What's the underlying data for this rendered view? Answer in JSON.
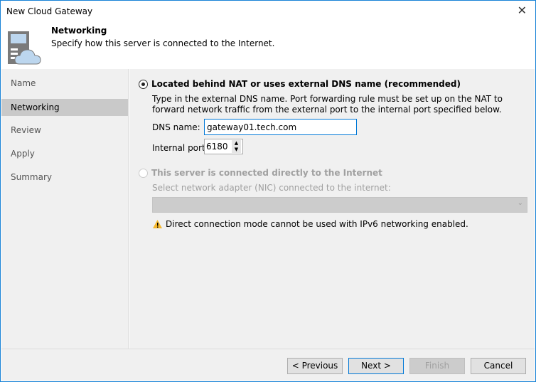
{
  "window": {
    "title": "New Cloud Gateway"
  },
  "header": {
    "title": "Networking",
    "subtitle": "Specify how this server is connected to the Internet."
  },
  "sidebar": {
    "items": [
      {
        "label": "Name"
      },
      {
        "label": "Networking"
      },
      {
        "label": "Review"
      },
      {
        "label": "Apply"
      },
      {
        "label": "Summary"
      }
    ]
  },
  "nat": {
    "label": "Located behind NAT or uses external DNS name (recommended)",
    "description": "Type in the external DNS name. Port forwarding rule must be set up on the NAT to forward network traffic from the external port to the internal port specified below.",
    "dns_label": "DNS name:",
    "dns_value": "gateway01.tech.com",
    "port_label": "Internal port:",
    "port_value": "6180"
  },
  "direct": {
    "label": "This server is connected directly to the Internet",
    "nic_label": "Select network adapter (NIC) connected to the internet:",
    "warning": "Direct connection mode cannot be used with IPv6 networking enabled."
  },
  "footer": {
    "previous": "< Previous",
    "next": "Next >",
    "finish": "Finish",
    "cancel": "Cancel"
  }
}
